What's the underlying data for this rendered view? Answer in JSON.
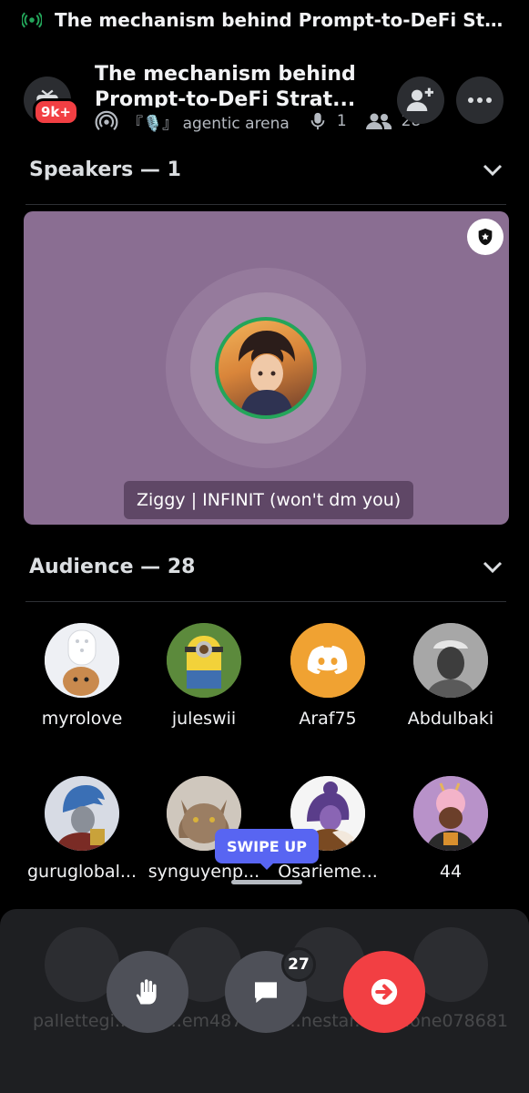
{
  "status_bar": {
    "title": "The mechanism behind Prompt-to-DeFi Strateg..."
  },
  "header": {
    "badge": "9k+",
    "title": "The mechanism behind Prompt-to-DeFi Strat...",
    "channel": "『🎙️』 agentic arena",
    "speaker_count": "1",
    "listener_count": "28"
  },
  "speakers": {
    "heading": "Speakers — 1",
    "items": [
      {
        "name": "Ziggy | INFINIT (won't dm you)"
      }
    ]
  },
  "audience": {
    "heading": "Audience — 28",
    "members": [
      {
        "name": "myrolove"
      },
      {
        "name": "juleswii"
      },
      {
        "name": "Araf75"
      },
      {
        "name": "Abdulbaki"
      },
      {
        "name": "guruglobal..."
      },
      {
        "name": "synguyenp..."
      },
      {
        "name": "Osarieme..."
      },
      {
        "name": "44"
      }
    ],
    "hidden_members": [
      {
        "name": "pallettegi..."
      },
      {
        "name": "...em487"
      },
      {
        "name": "...nestar..."
      },
      {
        "name": "...one078681"
      }
    ]
  },
  "tooltip": {
    "swipe_up": "SWIPE UP"
  },
  "controls": {
    "chat_badge": "27"
  },
  "colors": {
    "accent": "#5865f2",
    "danger": "#f23f43",
    "online": "#23a55a",
    "card": "#8a6e92"
  }
}
